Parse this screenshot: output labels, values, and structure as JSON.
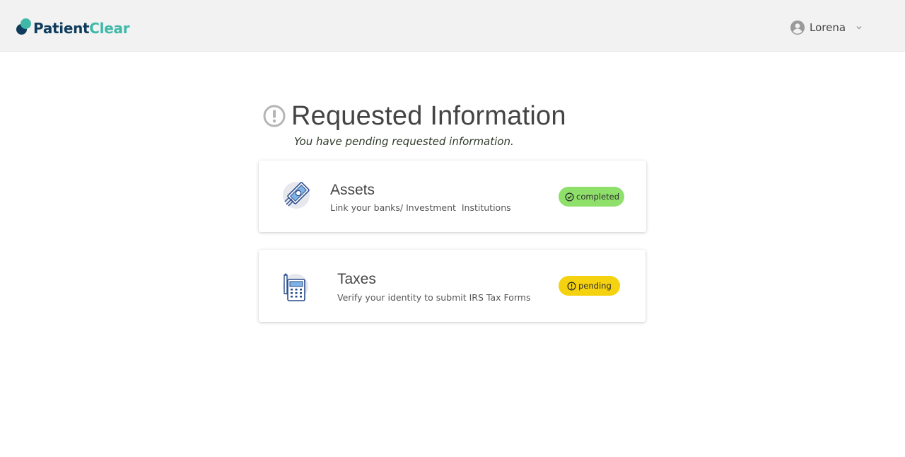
{
  "header": {
    "logo_part1": "Patient",
    "logo_part2": "Clear",
    "user_name": "Lorena",
    "logo_colors": {
      "dark": "#0f3b5c",
      "teal": "#3fb8a8"
    }
  },
  "main": {
    "title": "Requested Information",
    "subtitle": "You have pending requested information.",
    "cards": [
      {
        "title": "Assets",
        "description": "Link your banks/ Investment  Institutions",
        "icon": "money-bill-icon",
        "status": "completed",
        "status_color": "#8ee06b"
      },
      {
        "title": "Taxes",
        "description": "Verify your identity to submit IRS Tax Forms",
        "icon": "tax-calculator-icon",
        "status": "pending",
        "status_color": "#f5d20f"
      }
    ]
  }
}
